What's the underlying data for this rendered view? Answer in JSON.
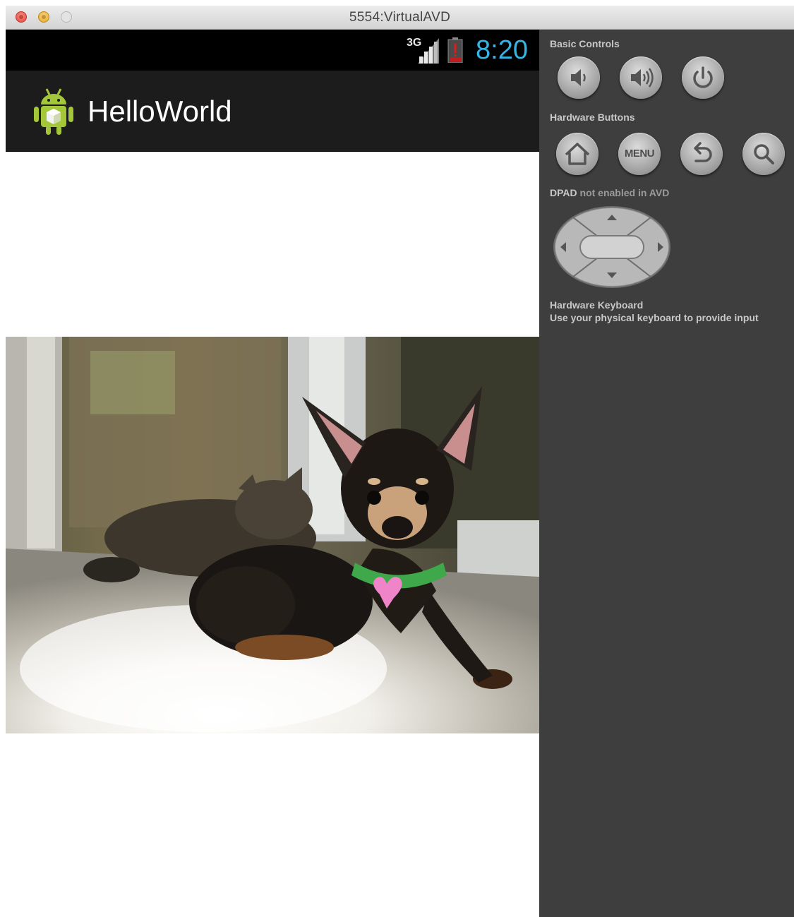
{
  "window": {
    "title": "5554:VirtualAVD"
  },
  "status_bar": {
    "network": "3G",
    "time": "8:20",
    "time_color": "#33b5e5"
  },
  "app": {
    "title": "HelloWorld",
    "photo_description": "dog-and-cat-photo"
  },
  "controls": {
    "basic_label": "Basic Controls",
    "hardware_label": "Hardware Buttons",
    "menu_label": "MENU",
    "dpad_label_strong": "DPAD",
    "dpad_label_rest": " not enabled in AVD",
    "keyboard_title": "Hardware Keyboard",
    "keyboard_hint": "Use your physical keyboard to provide input"
  },
  "icons": [
    "volume-down-icon",
    "volume-up-icon",
    "power-icon",
    "home-icon",
    "menu-icon",
    "back-icon",
    "search-icon",
    "dpad-icon",
    "android-icon",
    "signal-icon",
    "battery-icon"
  ]
}
